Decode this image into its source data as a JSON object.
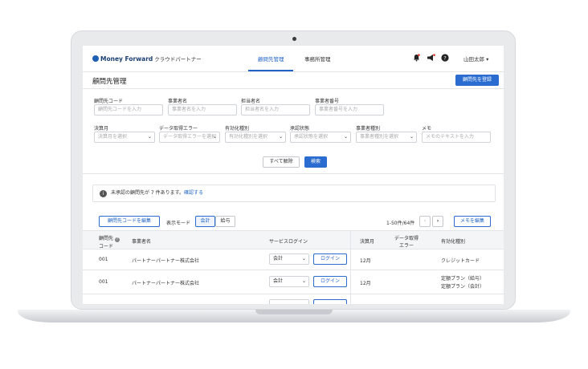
{
  "app": {
    "logo_brand": "Money Forward",
    "logo_product": "クラウドパートナー"
  },
  "nav": {
    "tab_clients": "顧問先管理",
    "tab_office": "事務所管理"
  },
  "header": {
    "user_name": "山田太郎"
  },
  "page": {
    "title": "顧問先管理",
    "register_button": "顧問先を登録"
  },
  "filters": {
    "client_code": {
      "label": "顧問先コード",
      "placeholder": "顧問先コードを入力"
    },
    "business_name": {
      "label": "事業者名",
      "placeholder": "事業者名を入力"
    },
    "assignee": {
      "label": "担当者名",
      "placeholder": "担当者名を入力"
    },
    "business_number": {
      "label": "事業者番号",
      "placeholder": "事業者番号を入力"
    },
    "closing_month": {
      "label": "決算月",
      "placeholder": "決算月を選択"
    },
    "data_error": {
      "label": "データ取得エラー",
      "placeholder": "データ取得エラーを選択"
    },
    "activation_type": {
      "label": "有効化種別",
      "placeholder": "有効化種別を選択"
    },
    "approval_status": {
      "label": "承認状態",
      "placeholder": "承認状態を選択"
    },
    "business_type": {
      "label": "事業者種別",
      "placeholder": "事業者種別を選択"
    },
    "memo": {
      "label": "メモ",
      "placeholder": "メモのテキストを入力"
    },
    "clear_button": "すべて解除",
    "search_button": "検索"
  },
  "notice": {
    "text": "未承認の顧問先が 7 件あります。",
    "link": "確認する"
  },
  "toolbar": {
    "edit_code_button": "顧問先コードを編集",
    "display_mode_label": "表示モード",
    "mode_accounting": "会計",
    "mode_payroll": "給与",
    "pagination": "1-50件/64件",
    "prev": "‹",
    "next": "›",
    "edit_memo_button": "メモを編集"
  },
  "table": {
    "headers": {
      "client_code_line1": "顧問先",
      "client_code_line2": "コード",
      "business_name": "事業者名",
      "service_login": "サービスログイン",
      "closing_month": "決算月",
      "data_error_line1": "データ取得",
      "data_error_line2": "エラー",
      "activation_type": "有効化種別"
    },
    "rows": [
      {
        "code": "001",
        "name": "パートナーパートナー株式会社",
        "service": "会計",
        "login": "ログイン",
        "closing": "12月",
        "activation_1": "クレジットカード",
        "activation_2": ""
      },
      {
        "code": "001",
        "name": "パートナーパートナー株式会社",
        "service": "会計",
        "login": "ログイン",
        "closing": "12月",
        "activation_1": "定額プラン（給与）",
        "activation_2": "定額プラン（会計）"
      }
    ]
  },
  "colors": {
    "accent": "#2a6ccf",
    "brand": "#1c3f73"
  }
}
